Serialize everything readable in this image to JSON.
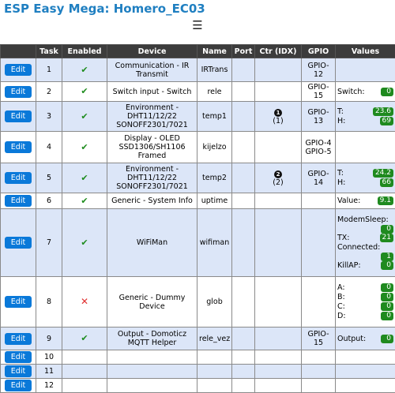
{
  "app": {
    "title": "ESP Easy Mega: Homero_EC03",
    "menu_icon": "☰"
  },
  "table": {
    "headers": [
      "",
      "Task",
      "Enabled",
      "Device",
      "Name",
      "Port",
      "Ctr (IDX)",
      "GPIO",
      "Values"
    ],
    "edit_label": "Edit",
    "enabled_symbol": "✔",
    "disabled_symbol": "✕",
    "rows": [
      {
        "task": "1",
        "device": "Communication - IR Transmit",
        "name": "IRTrans",
        "ctr_idx": "",
        "gpio": "GPIO-12"
      },
      {
        "task": "2",
        "device": "Switch input - Switch",
        "name": "rele",
        "gpio": "GPIO-15",
        "values": [
          {
            "label": "Switch:",
            "value": "0"
          }
        ]
      },
      {
        "task": "3",
        "device": "Environment - DHT11/12/22 SONOFF2301/7021",
        "name": "temp1",
        "ctr_num": "1",
        "ctr_idx": "(1)",
        "gpio": "GPIO-13",
        "values": [
          {
            "label": "T:",
            "value": "23.6"
          },
          {
            "label": "H:",
            "value": "69"
          }
        ]
      },
      {
        "task": "4",
        "device": "Display - OLED SSD1306/SH1106 Framed",
        "name": "kijelzo",
        "gpio": "GPIO-4",
        "gpio2": "GPIO-5"
      },
      {
        "task": "5",
        "device": "Environment - DHT11/12/22 SONOFF2301/7021",
        "name": "temp2",
        "ctr_num": "2",
        "ctr_idx": "(2)",
        "gpio": "GPIO-14",
        "values": [
          {
            "label": "T:",
            "value": "24.2"
          },
          {
            "label": "H:",
            "value": "66"
          }
        ]
      },
      {
        "task": "6",
        "device": "Generic - System Info",
        "name": "uptime",
        "values": [
          {
            "label": "Value:",
            "value": "9.1"
          }
        ]
      },
      {
        "task": "7",
        "device": "WiFiMan",
        "name": "wifiman",
        "values": [
          {
            "label": "ModemSleep:",
            "value": "0"
          },
          {
            "label": "TX:",
            "value": "21"
          },
          {
            "label": "Connected:",
            "value": "1"
          },
          {
            "label": "KillAP:",
            "value": "0"
          }
        ]
      },
      {
        "task": "8",
        "device": "Generic - Dummy Device",
        "name": "glob",
        "values": [
          {
            "label": "A:",
            "value": "0"
          },
          {
            "label": "B:",
            "value": "0"
          },
          {
            "label": "C:",
            "value": "0"
          },
          {
            "label": "D:",
            "value": "0"
          }
        ]
      },
      {
        "task": "9",
        "device": "Output - Domoticz MQTT Helper",
        "name": "rele_vez",
        "gpio": "GPIO-15",
        "values": [
          {
            "label": "Output:",
            "value": "0"
          }
        ]
      },
      {
        "task": "10"
      },
      {
        "task": "11"
      },
      {
        "task": "12"
      }
    ]
  }
}
